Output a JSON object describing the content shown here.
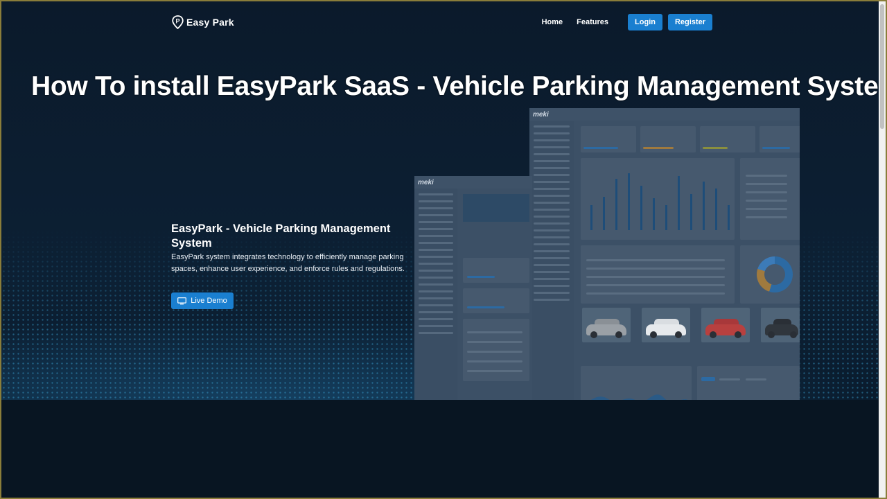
{
  "nav": {
    "brand": "Easy Park",
    "links": [
      "Home",
      "Features"
    ],
    "login_label": "Login",
    "register_label": "Register"
  },
  "headline": "How To install EasyPark SaaS - Vehicle Parking Management System",
  "hero": {
    "title": "EasyPark - Vehicle Parking Management System",
    "description": "EasyPark system integrates technology to efficiently manage parking spaces, enhance user experience, and enforce rules and regulations.",
    "demo_label": "Live Demo"
  },
  "preview": {
    "logo": "meki"
  },
  "colors": {
    "accent": "#1a7fd0",
    "background": "#081522"
  },
  "icons": [
    "parking-pin-icon",
    "monitor-icon"
  ]
}
